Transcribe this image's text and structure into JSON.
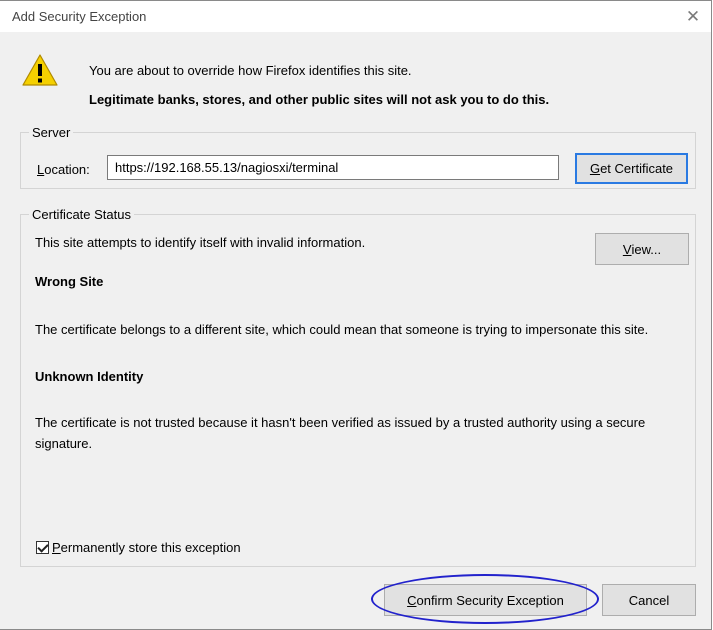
{
  "window": {
    "title": "Add Security Exception",
    "close_glyph": "✕"
  },
  "intro": {
    "icon": "warning-icon",
    "line1": "You are about to override how Firefox identifies this site.",
    "line2": "Legitimate banks, stores, and other public sites will not ask you to do this."
  },
  "server": {
    "legend": "Server",
    "location_label_prefix": "",
    "location_label_underlined": "L",
    "location_label_rest": "ocation:",
    "location_value": "https://192.168.55.13/nagiosxi/terminal",
    "get_cert_underlined": "G",
    "get_cert_rest": "et Certificate"
  },
  "status": {
    "legend": "Certificate Status",
    "summary": "This site attempts to identify itself with invalid information.",
    "view_underlined": "V",
    "view_rest": "iew...",
    "wrong_site_heading": "Wrong Site",
    "wrong_site_text": "The certificate belongs to a different site, which could mean that someone is trying to impersonate this site.",
    "unknown_identity_heading": "Unknown Identity",
    "unknown_identity_text": "The certificate is not trusted because it hasn't been verified as issued by a trusted authority using a secure signature."
  },
  "permanent": {
    "checked": true,
    "label_underlined": "P",
    "label_rest": "ermanently store this exception"
  },
  "buttons": {
    "confirm_underlined": "C",
    "confirm_rest": "onfirm Security Exception",
    "cancel": "Cancel"
  },
  "colors": {
    "focus_border": "#2a7ae2",
    "annotation_ellipse": "#2222cc"
  }
}
